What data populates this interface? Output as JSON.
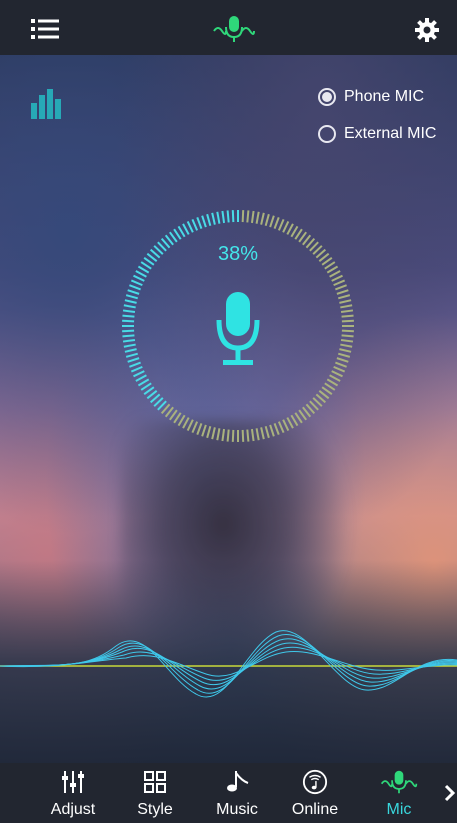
{
  "header": {
    "menu_icon": "menu-list-icon",
    "logo_icon": "microphone-wave-icon",
    "settings_icon": "gear-icon"
  },
  "equalizer_icon": "equalizer-bars-icon",
  "mic_source": {
    "options": [
      {
        "label": "Phone MIC",
        "selected": true
      },
      {
        "label": "External MIC",
        "selected": false
      }
    ]
  },
  "meter": {
    "percent_label": "38%",
    "level": 0.38,
    "center_icon": "microphone-icon"
  },
  "bottom_nav": {
    "items": [
      {
        "label": "Adjust",
        "icon": "sliders-icon",
        "active": false
      },
      {
        "label": "Style",
        "icon": "grid-icon",
        "active": false
      },
      {
        "label": "Music",
        "icon": "music-note-icon",
        "active": false
      },
      {
        "label": "Online",
        "icon": "online-music-icon",
        "active": false
      },
      {
        "label": "Mic",
        "icon": "microphone-wave-icon",
        "active": true
      }
    ],
    "more_icon": "chevron-right-icon"
  },
  "colors": {
    "accent": "#39d7dd",
    "topbar": "#222630",
    "text": "#ffffff"
  }
}
